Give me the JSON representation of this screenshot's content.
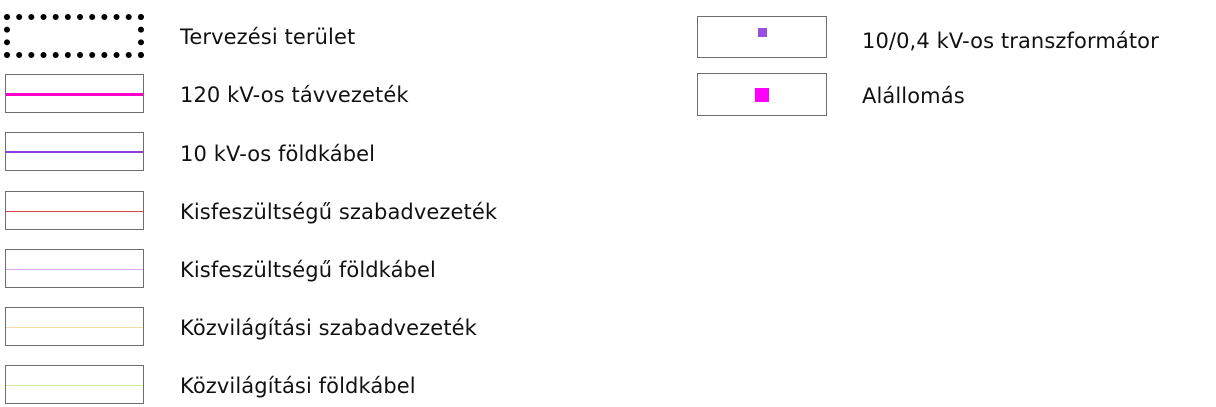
{
  "legend_left": [
    {
      "label": "Tervezési terület",
      "symbol": "dotted-area-outline",
      "color": "#000000"
    },
    {
      "label": "120 kV-os távvezeték",
      "symbol": "line",
      "color": "#ff00cc",
      "weight": "thick"
    },
    {
      "label": "10 kV-os földkábel",
      "symbol": "line",
      "color": "#8c3fe0",
      "weight": "medium"
    },
    {
      "label": "Kisfeszültségű szabadvezeték",
      "symbol": "line",
      "color": "#d6434b",
      "weight": "thin"
    },
    {
      "label": "Kisfeszültségű földkábel",
      "symbol": "line",
      "color": "#dca8f0",
      "weight": "thin"
    },
    {
      "label": "Közvilágítási szabadvezeték",
      "symbol": "line",
      "color": "#f2dca8",
      "weight": "thin"
    },
    {
      "label": "Közvilágítási földkábel",
      "symbol": "line",
      "color": "#cdeca0",
      "weight": "thin"
    }
  ],
  "legend_right": [
    {
      "label": "10/0,4 kV-os transzformátor",
      "symbol": "square",
      "color": "#9b4fe0",
      "size": "small"
    },
    {
      "label": "Alállomás",
      "symbol": "square",
      "color": "#ff00ff",
      "size": "medium"
    }
  ]
}
